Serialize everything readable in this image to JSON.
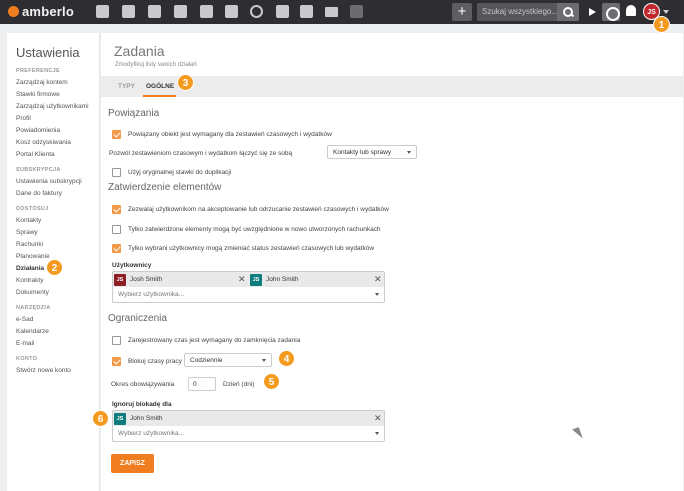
{
  "topbar": {
    "logo": "amberlo",
    "search_placeholder": "Szukaj wszystkiego...",
    "plus_label": "+",
    "avatar_initials": "JS"
  },
  "badges": [
    "1",
    "2",
    "3",
    "4",
    "5",
    "6"
  ],
  "sidebar": {
    "title": "Ustawienia",
    "sections": {
      "preferences": "PREFERENCJE",
      "subscription": "SUBSKRYPCJA",
      "access": "DOSTOSUJ",
      "tools": "NARZĘDZIA",
      "account": "KONTO"
    },
    "items": {
      "preferences": [
        "Zarządzaj kontem",
        "Stawki firmowe",
        "Zarządzaj użytkownikami",
        "Profil",
        "Powiadomienia",
        "Kosz odzyskiwania",
        "Portal Klienta"
      ],
      "subscription": [
        "Ustawienia subskrypcji",
        "Dane do faktury"
      ],
      "access": [
        "Kontakty",
        "Sprawy",
        "Rachunki",
        "Planowanie",
        "Działania",
        "Kontrakty",
        "Dokumenty"
      ],
      "tools": [
        "e-Sad",
        "Kalendarze",
        "E-mail"
      ],
      "account": [
        "Stwórz nowe konto"
      ]
    }
  },
  "page": {
    "title": "Zadania",
    "subtitle": "Zmodyfikuj listy swoich działań",
    "tabs": [
      "TYPY",
      "OGÓLNE"
    ]
  },
  "links": {
    "section_title": "Powiązania",
    "required_label": "Powiązany obiekt jest wymagany dla zestawień czasowych i wydatków",
    "join_label": "Pozwól zestawieniom czasowym i wydatkom łączyć się ze sobą",
    "join_value": "Kontakty lub sprawy",
    "original_rate_label": "Użyj oryginalnej stawki do duplikacji"
  },
  "approval": {
    "section_title": "Zatwierdzenie elementów",
    "allow_label": "Zezwalaj użytkownikom na akceptowanie lub odrzucanie zestawień czasowych i wydatków",
    "only_approved_label": "Tylko zatwierdzone elementy mogą być uwzględnione w nowo utworzonych rachunkach",
    "selected_users_label": "Tylko wybrani użytkownicy mogą zmieniać status zestawień czasowych lub wydatków",
    "users_heading": "Użytkownicy",
    "users": [
      {
        "initials": "JS",
        "name": "Josh Smith",
        "color": "#8e1f24"
      },
      {
        "initials": "JS",
        "name": "John Smith",
        "color": "#0e7d7d"
      }
    ],
    "users_placeholder": "Wybierz użytkownika..."
  },
  "limits": {
    "section_title": "Ograniczenia",
    "registered_label": "Zarejestrowany czas jest wymagany do zamknięcia zadania",
    "block_label": "Blokuj czasy pracy",
    "block_value": "Codziennie",
    "period_label": "Okres obowiązywania",
    "period_value": "0",
    "period_unit": "Dzień (dni)",
    "ignore_heading": "Ignoruj blokadę dla",
    "ignore_users": [
      {
        "initials": "JS",
        "name": "John Smith",
        "color": "#0e7d7d"
      }
    ],
    "ignore_placeholder": "Wybierz użytkownika..."
  },
  "save_label": "ZAPISZ",
  "colors": {
    "accent": "#f07d1f",
    "topbar": "#2d2d32",
    "badge": "#f39a1f"
  }
}
